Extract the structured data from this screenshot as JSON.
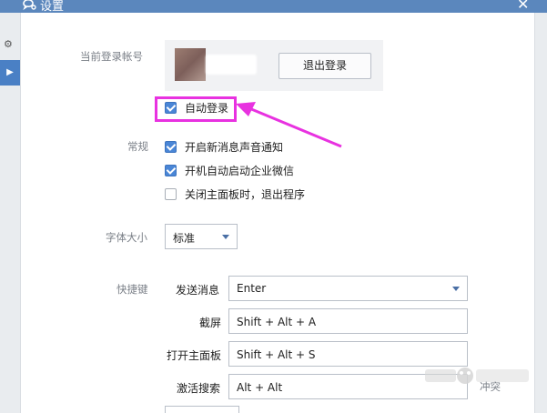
{
  "window": {
    "title": "设置",
    "close_glyph": "✕",
    "logo_icon": "wechat-work-icon"
  },
  "left_strip": {
    "icon": "gear-icon",
    "tab_glyph": "▶"
  },
  "account": {
    "label": "当前登录帐号",
    "logout_label": "退出登录",
    "auto_login": {
      "label": "自动登录",
      "checked": true
    }
  },
  "general": {
    "label": "常规",
    "options": [
      {
        "label": "开启新消息声音通知",
        "checked": true
      },
      {
        "label": "开机自动启动企业微信",
        "checked": true
      },
      {
        "label": "关闭主面板时，退出程序",
        "checked": false
      }
    ]
  },
  "font_size": {
    "label": "字体大小",
    "value": "标准"
  },
  "shortcuts": {
    "label": "快捷键",
    "items": [
      {
        "label": "发送消息",
        "value": "Enter",
        "is_select": true
      },
      {
        "label": "截屏",
        "value": "Shift + Alt + A"
      },
      {
        "label": "打开主面板",
        "value": "Shift + Alt + S"
      },
      {
        "label": "激活搜索",
        "value": "Alt + Alt"
      }
    ],
    "conflict_text": "冲突"
  },
  "annotation_color": "#e832e0",
  "accent_color": "#4a86d6"
}
